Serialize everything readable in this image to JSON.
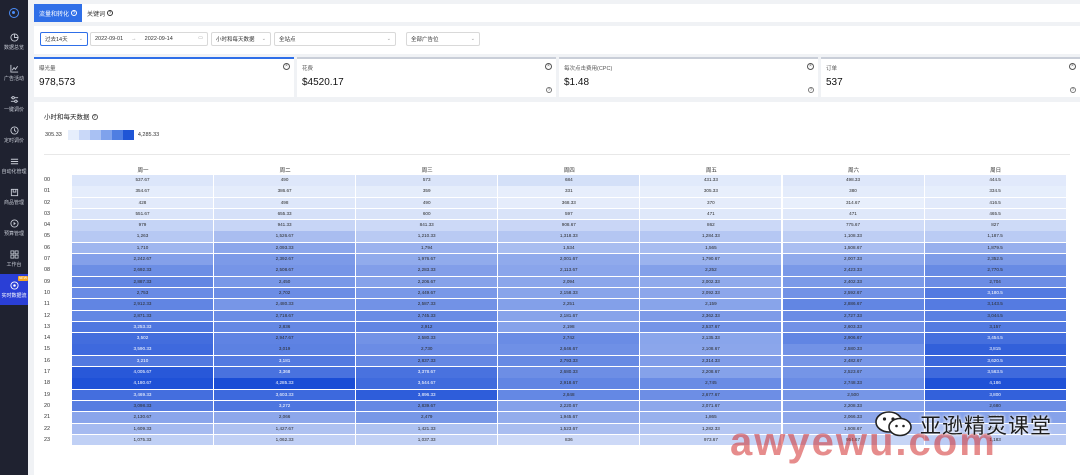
{
  "sidebar": {
    "items": [
      {
        "label": "数据总览",
        "icon": "pie-chart-icon"
      },
      {
        "label": "广告活动",
        "icon": "line-chart-icon"
      },
      {
        "label": "一键调价",
        "icon": "adjust-icon"
      },
      {
        "label": "定时调价",
        "icon": "clock-icon"
      },
      {
        "label": "自动化管理",
        "icon": "sliders-icon"
      },
      {
        "label": "商品管理",
        "icon": "box-icon"
      },
      {
        "label": "预算管理",
        "icon": "budget-icon"
      },
      {
        "label": "工作台",
        "icon": "grid-icon"
      },
      {
        "label": "实时数据流",
        "icon": "realtime-icon",
        "badge": "NEW",
        "active": true
      }
    ]
  },
  "tabs": [
    {
      "label": "流量和转化",
      "active": true
    },
    {
      "label": "关键词",
      "active": false
    }
  ],
  "filters": {
    "range": "过去14天",
    "date_start": "2022-09-01",
    "date_arrow": "→",
    "date_end": "2022-09-14",
    "granularity": "小时和每天数据",
    "site": "全站点",
    "campaign": "全部广告位"
  },
  "cards": [
    {
      "label": "曝光量",
      "value": "978,573"
    },
    {
      "label": "花费",
      "value": "$4520.17"
    },
    {
      "label": "每次点击费用(CPC)",
      "value": "$1.48"
    },
    {
      "label": "订单",
      "value": "537"
    }
  ],
  "panel": {
    "title": "小时和每天数据",
    "legend_min": "305.33",
    "legend_max": "4,285.33",
    "legend_colors": [
      "#e6eefc",
      "#c9d8f8",
      "#a9c1f3",
      "#7fa2ec",
      "#4f7ee2",
      "#1f55d6"
    ]
  },
  "chart_data": {
    "type": "heatmap",
    "x": [
      "周一",
      "周二",
      "周三",
      "周四",
      "周五",
      "周六",
      "周日"
    ],
    "y": [
      "00",
      "01",
      "02",
      "03",
      "04",
      "05",
      "06",
      "07",
      "08",
      "09",
      "10",
      "11",
      "12",
      "13",
      "14",
      "15",
      "16",
      "17",
      "18",
      "19",
      "20",
      "21",
      "22",
      "23"
    ],
    "color_range": [
      305.33,
      4285.33
    ],
    "values": [
      [
        "537.67",
        "490",
        "573",
        "684",
        "431.33",
        "498.33",
        "444.5"
      ],
      [
        "354.67",
        "386.67",
        "359",
        "331",
        "305.33",
        "380",
        "334.5"
      ],
      [
        "428",
        "498",
        "490",
        "368.33",
        "370",
        "314.67",
        "416.5"
      ],
      [
        "551.67",
        "655.33",
        "600",
        "597",
        "471",
        "471",
        "465.5"
      ],
      [
        "979",
        "941.33",
        "841.33",
        "908.67",
        "862",
        "775.67",
        "827"
      ],
      [
        "1,263",
        "1,526.67",
        "1,210.33",
        "1,318.33",
        "1,284.33",
        "1,108.33",
        "1,187.5"
      ],
      [
        "1,710",
        "2,093.33",
        "1,794",
        "1,534",
        "1,565",
        "1,508.67",
        "1,879.5"
      ],
      [
        "2,242.67",
        "2,392.67",
        "1,976.67",
        "2,001.67",
        "1,790.67",
        "2,007.33",
        "2,352.5"
      ],
      [
        "2,692.33",
        "2,508.67",
        "2,283.33",
        "2,113.67",
        "2,252",
        "2,423.33",
        "2,770.5"
      ],
      [
        "2,887.33",
        "2,450",
        "2,206.67",
        "2,094",
        "2,002.33",
        "2,402.33",
        "2,704"
      ],
      [
        "2,753",
        "2,702",
        "2,449.67",
        "2,158.33",
        "2,092.33",
        "2,592.67",
        "3,180.5"
      ],
      [
        "2,912.33",
        "2,480.33",
        "2,587.33",
        "2,251",
        "2,159",
        "2,886.67",
        "3,143.5"
      ],
      [
        "2,871.33",
        "2,718.67",
        "2,745.33",
        "2,181.67",
        "2,362.33",
        "2,727.33",
        "3,044.5"
      ],
      [
        "3,253.33",
        "2,836",
        "2,912",
        "2,198",
        "2,537.67",
        "2,603.33",
        "3,157"
      ],
      [
        "3,502",
        "2,947.67",
        "2,580.33",
        "2,742",
        "2,135.33",
        "2,906.67",
        "3,454.5"
      ],
      [
        "3,590.33",
        "3,019",
        "2,730",
        "2,646.67",
        "2,108.67",
        "2,580.33",
        "3,815"
      ],
      [
        "3,210",
        "3,181",
        "2,837.33",
        "2,793.33",
        "2,314.33",
        "2,482.67",
        "3,620.5"
      ],
      [
        "4,005.67",
        "3,368",
        "3,378.67",
        "2,680.33",
        "2,208.67",
        "2,523.67",
        "3,563.5"
      ],
      [
        "4,180.67",
        "4,285.33",
        "3,544.67",
        "2,918.67",
        "2,745",
        "2,748.33",
        "4,186"
      ],
      [
        "3,469.33",
        "3,603.33",
        "3,896.33",
        "2,848",
        "2,677.67",
        "2,500",
        "3,800"
      ],
      [
        "3,098.33",
        "3,272",
        "2,839.67",
        "2,220.67",
        "2,071.67",
        "2,208.33",
        "2,680"
      ],
      [
        "2,130.67",
        "2,066",
        "2,479",
        "1,945.67",
        "1,865",
        "2,066.33",
        "2,204.5"
      ],
      [
        "1,609.33",
        "1,427.67",
        "1,421.33",
        "1,523.67",
        "1,282.33",
        "1,508.67",
        "1,400.5"
      ],
      [
        "1,075.33",
        "1,062.33",
        "1,037.33",
        "836",
        "973.67",
        "954.67",
        "1,183"
      ]
    ]
  },
  "watermark": {
    "brand": "亚逊精灵课堂",
    "url": "awyewu.com"
  }
}
